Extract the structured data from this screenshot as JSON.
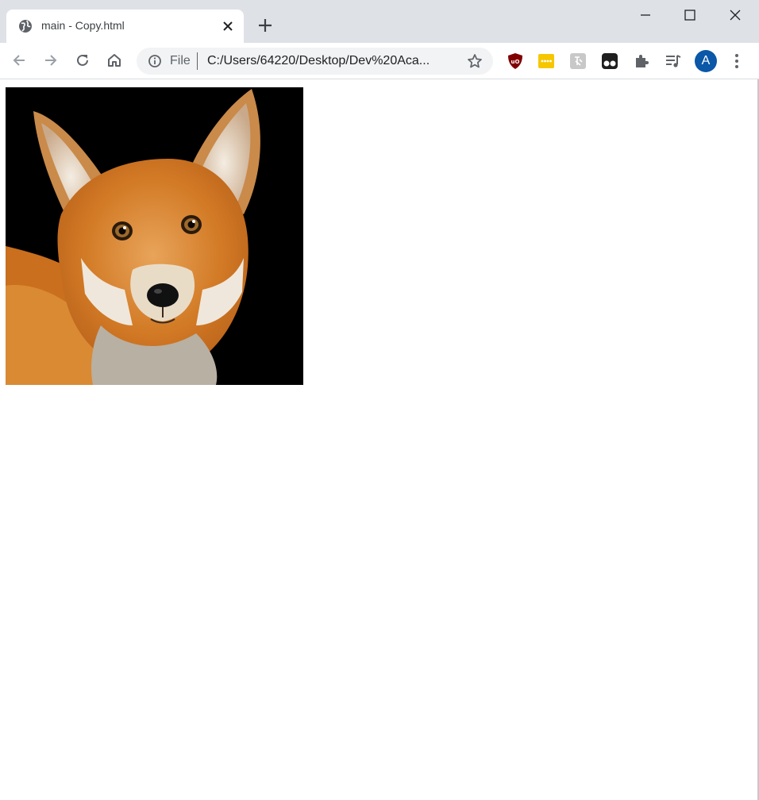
{
  "browser": {
    "tab": {
      "title": "main - Copy.html",
      "favicon": "globe-icon"
    },
    "window_controls": [
      "minimize-icon",
      "maximize-icon",
      "close-icon"
    ],
    "nav": [
      "back-icon",
      "forward-icon",
      "reload-icon",
      "home-icon"
    ],
    "omnibox": {
      "scheme_label": "File",
      "url": "C:/Users/64220/Desktop/Dev%20Aca..."
    },
    "extensions": [
      "ublock-icon",
      "password-manager-icon",
      "translator-icon",
      "tampermonkey-icon",
      "extensions-puzzle-icon",
      "media-queue-icon"
    ],
    "profile_initial": "A",
    "colors": {
      "tabstrip": "#dee1e6",
      "avatar": "#0b57a8",
      "ublock": "#800000",
      "pwmgr": "#f6c700"
    }
  },
  "page": {
    "image": {
      "subject": "red fox portrait",
      "background": "#000000"
    }
  }
}
